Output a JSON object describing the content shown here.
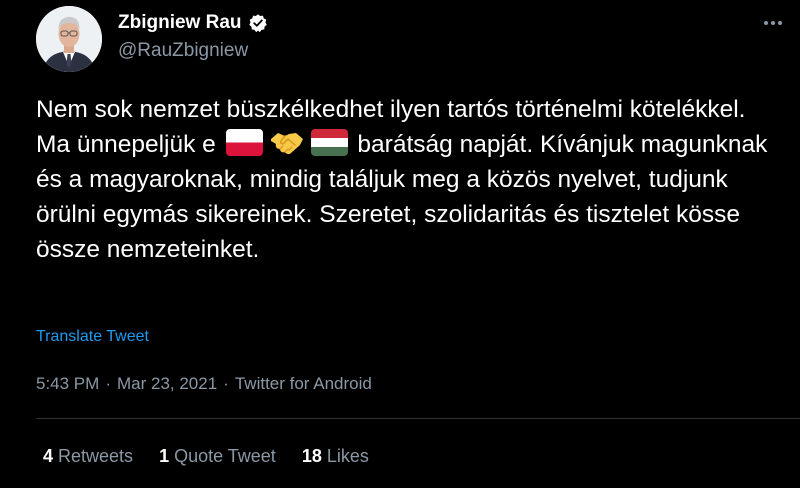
{
  "colors": {
    "background": "#000000",
    "text": "#ffffff",
    "secondary": "#8b98a5",
    "link": "#1d9bf0",
    "verified": "#ffffff"
  },
  "author": {
    "display_name": "Zbigniew Rau",
    "handle": "@RauZbigniew",
    "avatar_icon": "profile-photo",
    "verified_icon": "verified-badge-icon",
    "more_icon": "more-options-icon"
  },
  "tweet": {
    "text_before_emoji": "Nem sok nemzet büszkélkedhet ilyen tartós történelmi kötelékkel. Ma ünnepeljük e",
    "emojis": [
      "flag-poland",
      "handshake",
      "flag-hungary"
    ],
    "text_after_emoji": "barátság napját. Kívánjuk magunknak és a magyaroknak, mindig találjuk meg a közös nyelvet, tudjunk örülni egymás sikereinek. Szeretet, szolidaritás és tisztelet kösse össze nemzeteinket.",
    "translate_label": "Translate Tweet"
  },
  "meta": {
    "time": "5:43 PM",
    "date": "Mar 23, 2021",
    "source": "Twitter for Android",
    "separator": "·"
  },
  "stats": {
    "retweets_count": "4",
    "retweets_label": "Retweets",
    "quotes_count": "1",
    "quotes_label": "Quote Tweet",
    "likes_count": "18",
    "likes_label": "Likes"
  }
}
